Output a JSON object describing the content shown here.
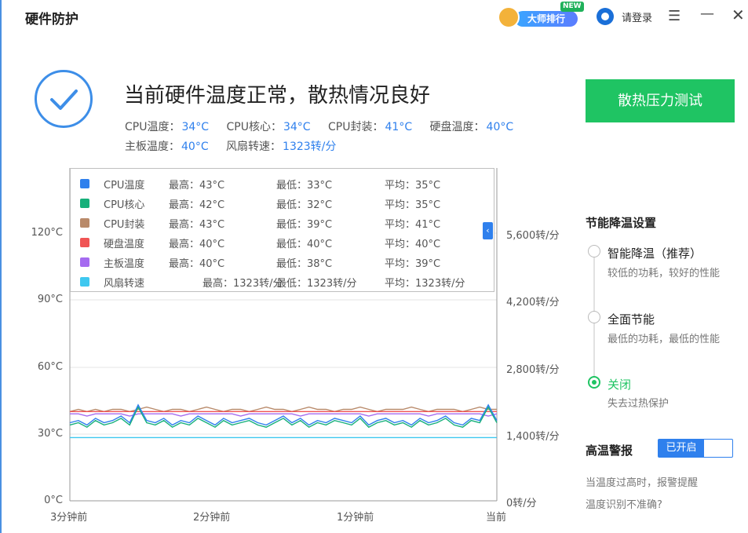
{
  "header": {
    "title": "硬件防护",
    "rank_label": "大师排行",
    "rank_badge": "NEW",
    "login_label": "请登录",
    "menu_icon": "hamburger-icon",
    "minimize_icon": "minimize-icon",
    "close_icon": "close-icon"
  },
  "status": {
    "headline": "当前硬件温度正常，散热情况良好",
    "stats": [
      {
        "label": "CPU温度：",
        "value": "34°C"
      },
      {
        "label": "CPU核心：",
        "value": "34°C"
      },
      {
        "label": "CPU封装：",
        "value": "41°C"
      },
      {
        "label": "硬盘温度：",
        "value": "40°C"
      },
      {
        "label": "主板温度：",
        "value": "40°C"
      },
      {
        "label": "风扇转速：",
        "value": "1323转/分"
      }
    ],
    "stress_test_button": "散热压力测试"
  },
  "chart": {
    "left_axis": [
      "120°C",
      "90°C",
      "60°C",
      "30°C",
      "0°C"
    ],
    "right_axis": [
      "5,600转/分",
      "4,200转/分",
      "2,800转/分",
      "1,400转/分",
      "0转/分"
    ],
    "x_labels": [
      "3分钟前",
      "2分钟前",
      "1分钟前",
      "当前"
    ],
    "collapse_label": "‹",
    "legend": [
      {
        "name": "CPU温度",
        "color": "#2f80ed",
        "max": "最高：43°C",
        "min": "最低：33°C",
        "avg": "平均：35°C"
      },
      {
        "name": "CPU核心",
        "color": "#16b07a",
        "max": "最高：42°C",
        "min": "最低：32°C",
        "avg": "平均：35°C"
      },
      {
        "name": "CPU封装",
        "color": "#b98a6a",
        "max": "最高：43°C",
        "min": "最低：39°C",
        "avg": "平均：41°C"
      },
      {
        "name": "硬盘温度",
        "color": "#f05454",
        "max": "最高：40°C",
        "min": "最低：40°C",
        "avg": "平均：40°C"
      },
      {
        "name": "主板温度",
        "color": "#a56bf0",
        "max": "最高：40°C",
        "min": "最低：38°C",
        "avg": "平均：39°C"
      },
      {
        "name": "风扇转速",
        "color": "#3fc8f0",
        "max": "最高：1323转/分",
        "min": "最低：1323转/分",
        "avg": "平均：1323转/分"
      }
    ]
  },
  "chart_data": {
    "type": "line",
    "x": [
      "3分钟前",
      "2分钟前",
      "1分钟前",
      "当前"
    ],
    "ylim": [
      0,
      120
    ],
    "y2lim": [
      0,
      5600
    ],
    "grid": true,
    "legend_position": "top",
    "series": [
      {
        "name": "CPU封装",
        "axis": "left",
        "values": [
          40,
          41,
          40,
          41,
          40,
          41,
          41,
          40,
          41,
          42,
          41,
          40,
          41,
          41,
          40,
          41,
          42,
          41,
          40,
          41,
          41,
          40,
          41,
          42,
          41,
          41,
          40,
          41,
          42,
          41,
          41,
          40,
          41,
          41,
          42,
          41,
          40,
          41,
          41,
          41,
          42,
          41,
          40,
          41,
          41,
          41,
          40,
          41,
          42,
          41,
          41
        ]
      },
      {
        "name": "硬盘温度",
        "axis": "left",
        "values": [
          40,
          40,
          40,
          40,
          40,
          40,
          40,
          40,
          40,
          40,
          40,
          40,
          40,
          40,
          40,
          40,
          40,
          40,
          40,
          40,
          40,
          40,
          40,
          40,
          40,
          40,
          40,
          40,
          40,
          40,
          40,
          40,
          40,
          40,
          40,
          40,
          40,
          40,
          40,
          40,
          40,
          40,
          40,
          40,
          40,
          40,
          40,
          40,
          40,
          40,
          40
        ]
      },
      {
        "name": "主板温度",
        "axis": "left",
        "values": [
          39,
          39,
          38,
          39,
          39,
          39,
          39,
          38,
          39,
          39,
          39,
          39,
          39,
          38,
          39,
          39,
          39,
          39,
          39,
          39,
          38,
          39,
          39,
          39,
          39,
          39,
          39,
          38,
          39,
          39,
          39,
          39,
          39,
          39,
          39,
          38,
          39,
          39,
          39,
          39,
          39,
          39,
          38,
          39,
          39,
          39,
          39,
          39,
          39,
          38,
          39
        ]
      },
      {
        "name": "CPU核心",
        "axis": "left",
        "values": [
          34,
          35,
          33,
          36,
          34,
          35,
          37,
          34,
          42,
          35,
          34,
          36,
          33,
          35,
          34,
          37,
          35,
          33,
          36,
          34,
          35,
          36,
          34,
          33,
          35,
          37,
          34,
          36,
          33,
          35,
          34,
          36,
          35,
          34,
          37,
          33,
          35,
          36,
          34,
          35,
          33,
          36,
          34,
          35,
          37,
          34,
          33,
          36,
          35,
          42,
          35
        ]
      },
      {
        "name": "CPU温度",
        "axis": "left",
        "values": [
          35,
          36,
          34,
          37,
          35,
          36,
          38,
          35,
          43,
          36,
          35,
          37,
          34,
          36,
          35,
          38,
          36,
          34,
          37,
          35,
          36,
          37,
          35,
          34,
          36,
          38,
          35,
          37,
          34,
          36,
          35,
          37,
          36,
          35,
          38,
          34,
          36,
          37,
          35,
          36,
          34,
          37,
          35,
          36,
          38,
          35,
          34,
          37,
          36,
          43,
          36
        ]
      },
      {
        "name": "风扇转速",
        "axis": "right",
        "values": [
          1323,
          1323,
          1323,
          1323,
          1323,
          1323,
          1323,
          1323,
          1323,
          1323,
          1323,
          1323,
          1323,
          1323,
          1323,
          1323,
          1323,
          1323,
          1323,
          1323,
          1323,
          1323,
          1323,
          1323,
          1323,
          1323,
          1323,
          1323,
          1323,
          1323,
          1323,
          1323,
          1323,
          1323,
          1323,
          1323,
          1323,
          1323,
          1323,
          1323,
          1323,
          1323,
          1323,
          1323,
          1323,
          1323,
          1323,
          1323,
          1323,
          1323,
          1323
        ]
      }
    ]
  },
  "settings": {
    "section_title": "节能降温设置",
    "options": [
      {
        "label": "智能降温（推荐）",
        "desc": "较低的功耗，较好的性能",
        "selected": false
      },
      {
        "label": "全面节能",
        "desc": "最低的功耗，最低的性能",
        "selected": false
      },
      {
        "label": "关闭",
        "desc": "失去过热保护",
        "selected": true
      }
    ],
    "alarm_title": "高温警报",
    "alarm_toggle": "已开启",
    "alarm_desc": "当温度过高时，报警提醒",
    "alarm_link": "温度识别不准确?"
  },
  "colors": {
    "accent": "#2f80ed",
    "green": "#1fc463"
  }
}
